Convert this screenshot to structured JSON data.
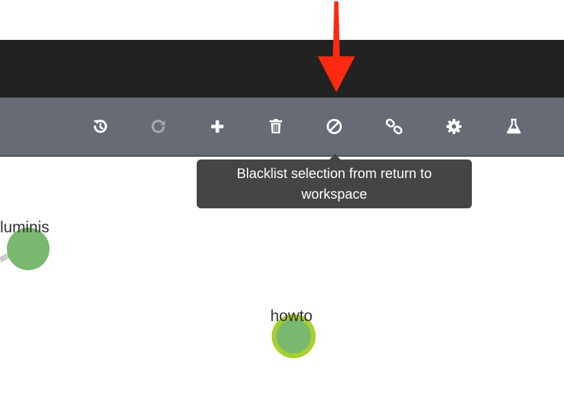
{
  "toolbar": {
    "buttons": [
      {
        "name": "undo",
        "icon": "history-undo-icon"
      },
      {
        "name": "redo",
        "icon": "redo-icon"
      },
      {
        "name": "add",
        "icon": "plus-icon"
      },
      {
        "name": "delete",
        "icon": "trash-icon"
      },
      {
        "name": "blacklist",
        "icon": "ban-icon"
      },
      {
        "name": "link",
        "icon": "chain-link-icon"
      },
      {
        "name": "settings",
        "icon": "gear-icon"
      },
      {
        "name": "experimental",
        "icon": "flask-icon"
      }
    ]
  },
  "tooltip": {
    "text": "Blacklist selection from return to workspace"
  },
  "graph": {
    "nodes": [
      {
        "label": "luminis",
        "color": "#79b86f"
      },
      {
        "label": "howto",
        "color": "#79b86f",
        "selected_ring": "#a6cf2f"
      }
    ],
    "edge_color": "#cccccc"
  },
  "colors": {
    "header": "#222222",
    "toolbar": "#666b76",
    "annotation_arrow": "#ff2a10"
  }
}
